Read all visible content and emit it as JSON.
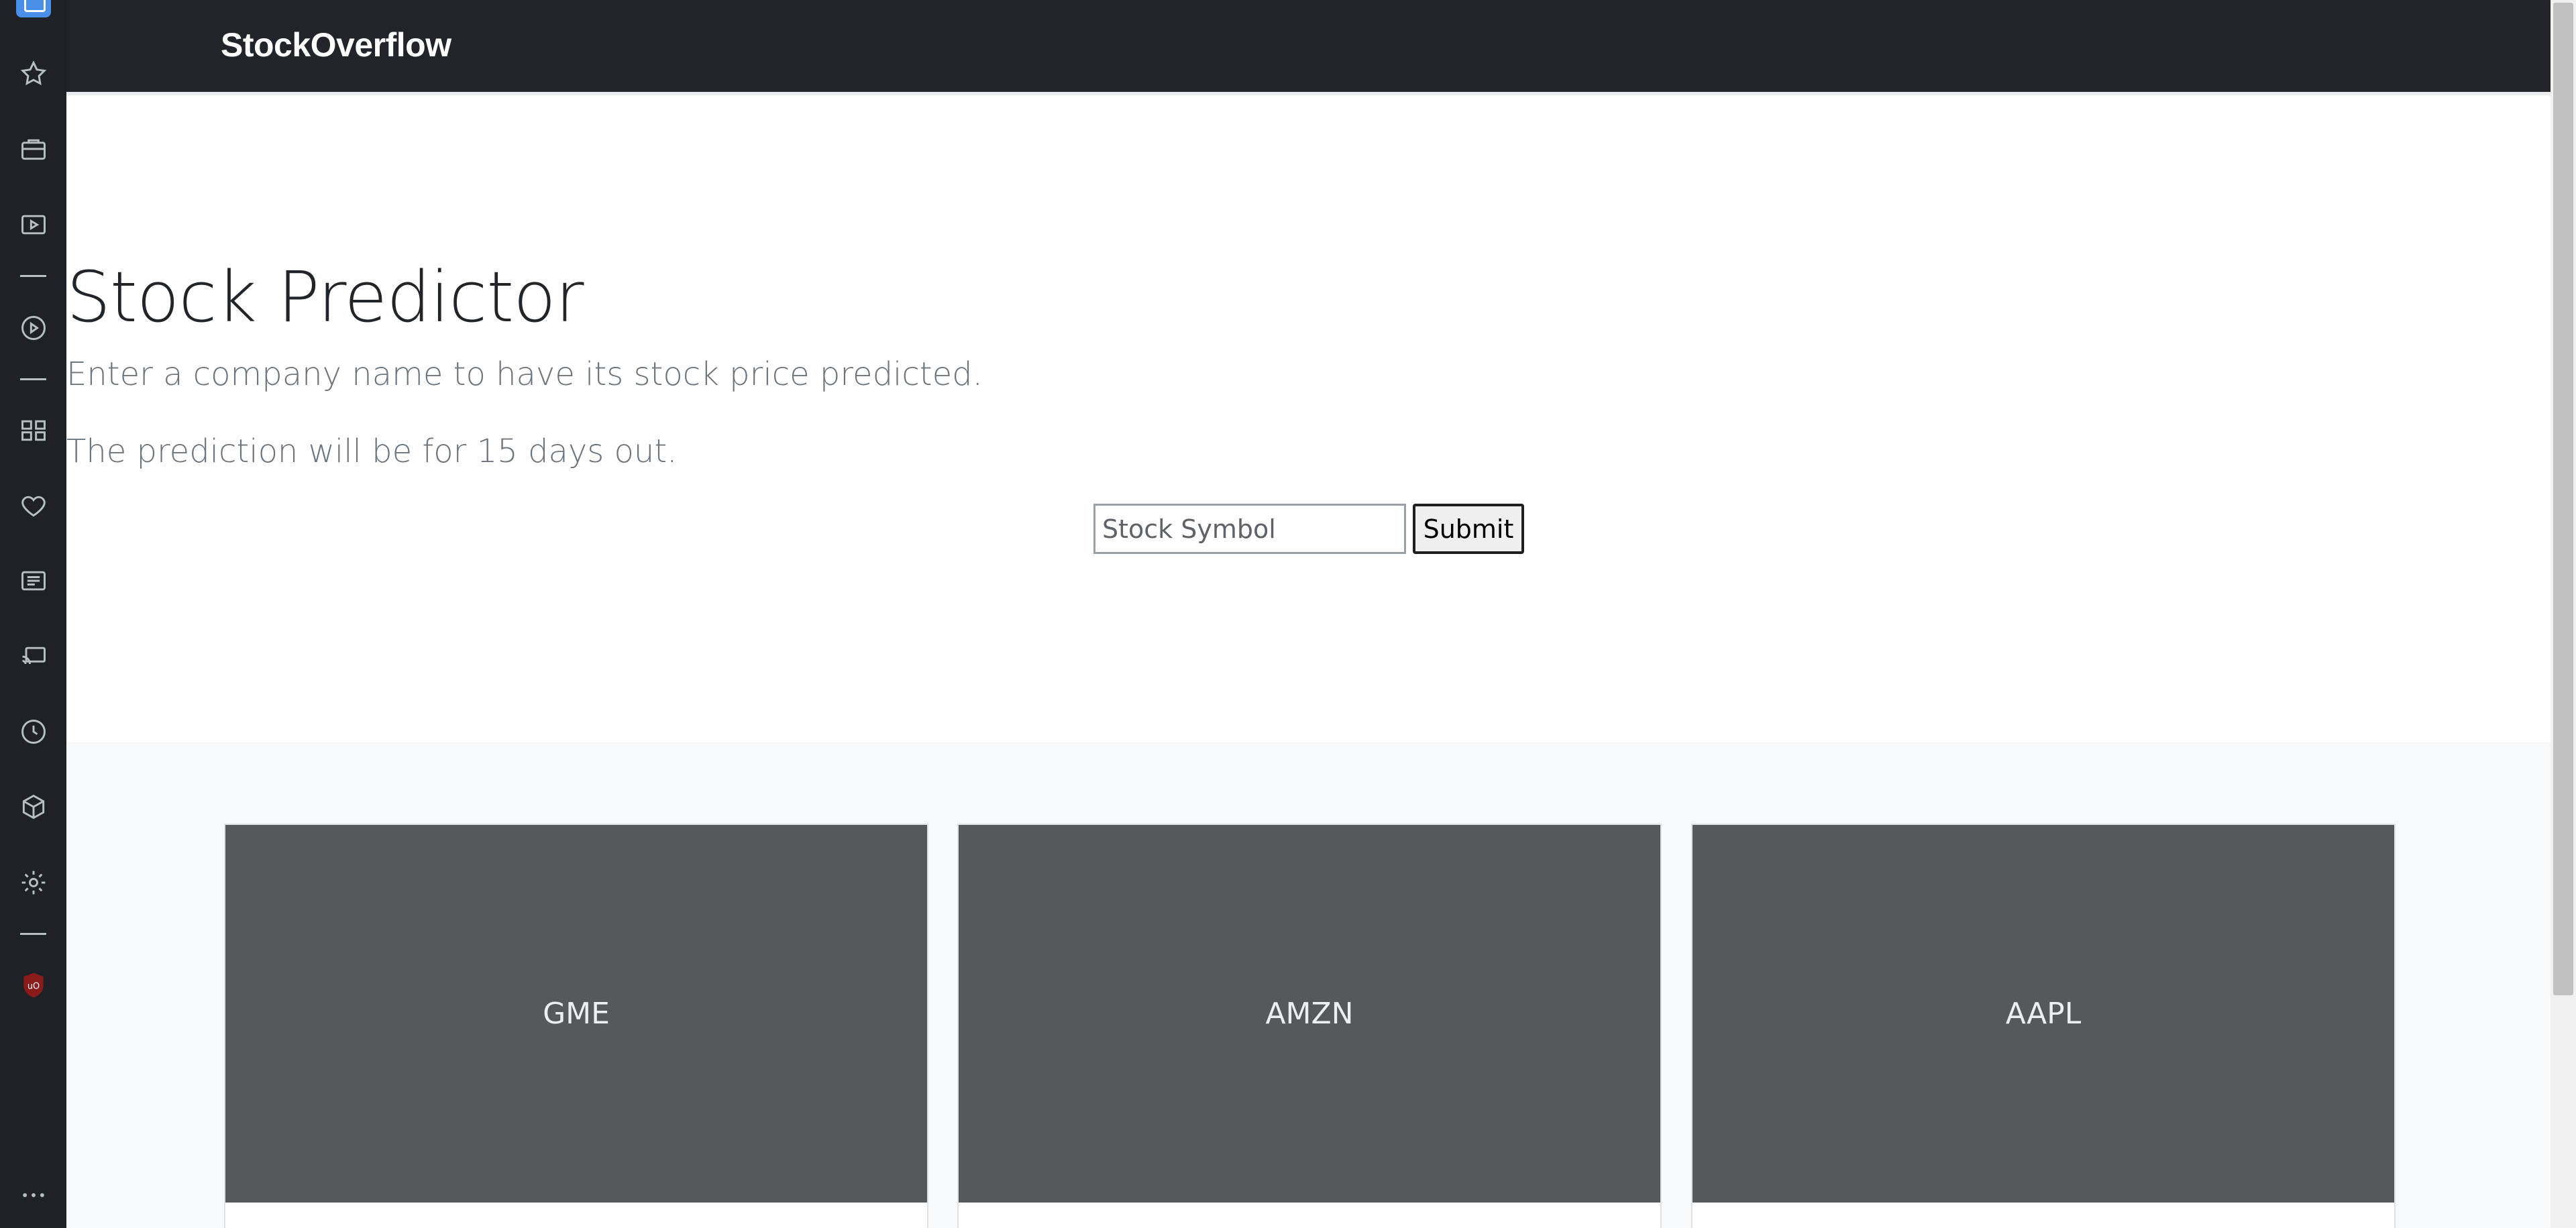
{
  "brand": {
    "name": "StockOverflow"
  },
  "hero": {
    "title": "Stock Predictor",
    "lead": "Enter a company name to have its stock price predicted.",
    "sub": "The prediction will be for 15 days out.",
    "input_placeholder": "Stock Symbol",
    "input_value": "",
    "submit_label": "Submit"
  },
  "cards": [
    {
      "label": "GME"
    },
    {
      "label": "AMZN"
    },
    {
      "label": "AAPL"
    }
  ],
  "sidebar": {
    "items": [
      "tab-icon",
      "star-icon",
      "briefcase-icon",
      "video-icon",
      "play-icon",
      "apps-icon",
      "heart-icon",
      "news-icon",
      "cast-icon",
      "history-icon",
      "box-icon",
      "gear-icon",
      "ublock-icon",
      "more-icon"
    ]
  },
  "colors": {
    "navbar": "#212529",
    "card_image": "#55595c",
    "album_background": "#f8f9fa",
    "rail": "#1e2227"
  }
}
